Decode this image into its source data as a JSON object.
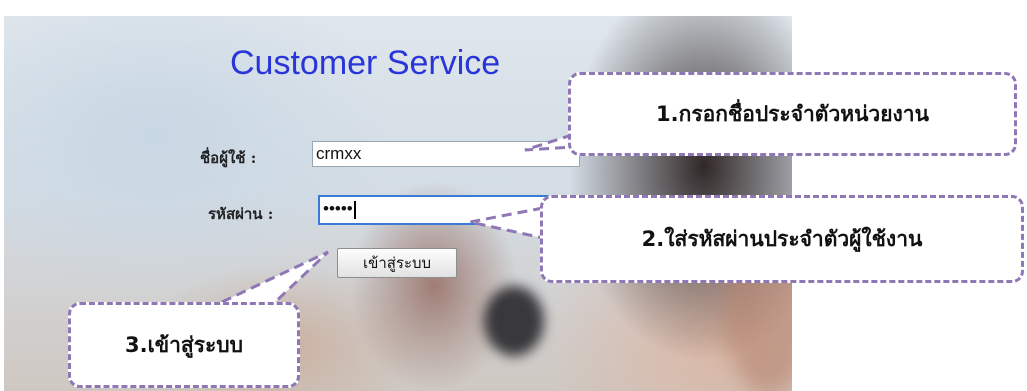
{
  "login": {
    "title": "Customer Service",
    "username_label": "ชื่อผู้ใช้ :",
    "username_value": "crmxx",
    "password_label": "รหัสผ่าน :",
    "password_value": "•••••",
    "submit_label": "เข้าสู่ระบบ"
  },
  "callouts": {
    "step1": "1.กรอกชื่อประจำตัวหน่วยงาน",
    "step2": "2.ใส่รหัสผ่านประจำตัวผู้ใช้งาน",
    "step3": "3.เข้าสู่ระบบ"
  },
  "colors": {
    "title": "#2a35d8",
    "callout_border": "#8f77b5"
  }
}
